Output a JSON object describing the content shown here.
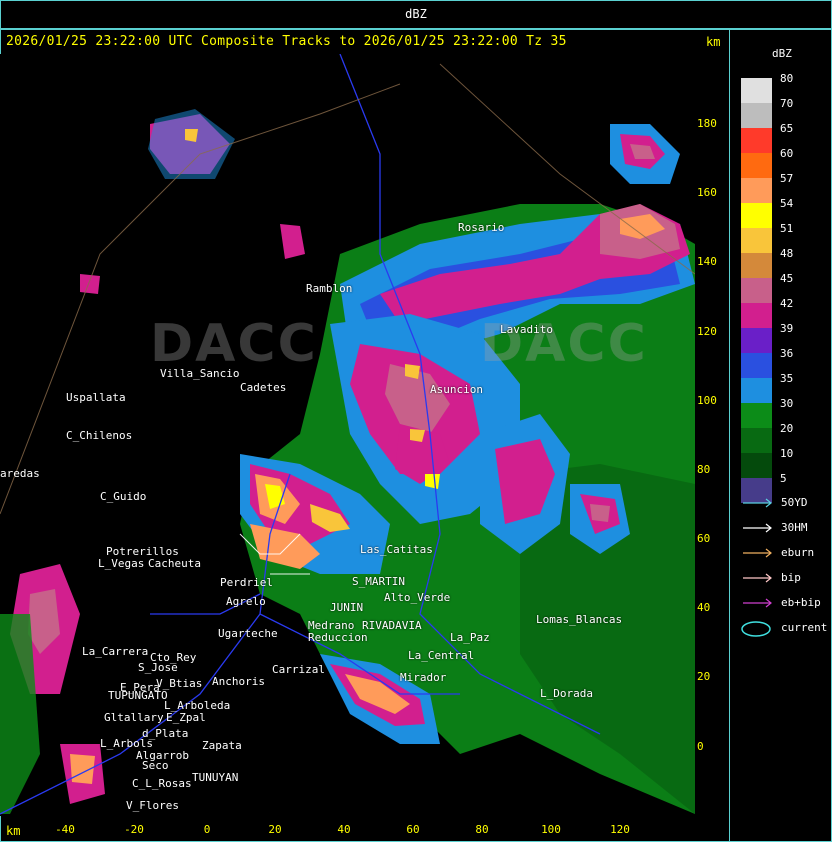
{
  "top_title": "dBZ",
  "header": "2026/01/25 23:22:00 UTC Composite Tracks to 2026/01/25 23:22:00 Tz 35",
  "km_top": "km",
  "km_bottom": "km",
  "y_ticks": [
    "180",
    "160",
    "140",
    "120",
    "100",
    "80",
    "60",
    "40",
    "20",
    "0"
  ],
  "x_ticks": [
    "-40",
    "-20",
    "0",
    "20",
    "40",
    "60",
    "80",
    "100",
    "120"
  ],
  "places": [
    "Ramblon",
    "Villa_Sancio",
    "Uspallata",
    "C_Chilenos",
    "aredas",
    "C_Guido",
    "Potrerillos",
    "L_Vegas",
    "Cacheuta",
    "Perdriel",
    "Agrelo",
    "Ugarteche",
    "La_Carrera",
    "Cto_Rey",
    "S_Jose",
    "E_Pera",
    "V_Btias",
    "TUPUNGATO",
    "Anchoris",
    "L_Arboleda",
    "Gltallary",
    "E_Zpal",
    "d_Plata",
    "L_Arbols",
    "Zapata",
    "Algarrob",
    "Seco",
    "C_L_Rosas",
    "TUNUYAN",
    "V_Flores",
    "Carrizal",
    "S_MARTIN",
    "RIVADAVIA",
    "JUNIN",
    "Medrano",
    "Reduccion",
    "Lomas_Blancas",
    "L_Dorada",
    "Rosario",
    "Lavadito",
    "Asuncion",
    "Cadetes",
    "Alto_Verde",
    "La_Central",
    "Mirador",
    "La_Paz",
    "Las_Catitas"
  ],
  "watermarks": [
    "DACC",
    "DACC"
  ],
  "legend": {
    "title": "dBZ",
    "levels": [
      {
        "label": "80",
        "color": "#e0e0e0"
      },
      {
        "label": "70",
        "color": "#bdbdbd"
      },
      {
        "label": "65",
        "color": "#ff3a2a"
      },
      {
        "label": "60",
        "color": "#ff6a10"
      },
      {
        "label": "57",
        "color": "#ff9b5a"
      },
      {
        "label": "54",
        "color": "#ffff00"
      },
      {
        "label": "51",
        "color": "#f9c53a"
      },
      {
        "label": "48",
        "color": "#d4893a"
      },
      {
        "label": "45",
        "color": "#c8608a"
      },
      {
        "label": "42",
        "color": "#d21f8e"
      },
      {
        "label": "39",
        "color": "#6a1fc8"
      },
      {
        "label": "36",
        "color": "#2a50e0"
      },
      {
        "label": "35",
        "color": "#1e8fe0"
      },
      {
        "label": "30",
        "color": "#0c8c18"
      },
      {
        "label": "20",
        "color": "#086a12"
      },
      {
        "label": "10",
        "color": "#044a0c"
      },
      {
        "label": "5",
        "color": "#463c8a"
      }
    ],
    "tracks": [
      {
        "label": "50YD",
        "color": "#5ad0e0"
      },
      {
        "label": "30HM",
        "color": "#ffffff"
      },
      {
        "label": "eburn",
        "color": "#f0b060"
      },
      {
        "label": "bip",
        "color": "#ffc8c8"
      },
      {
        "label": "eb+bip",
        "color": "#d040d0"
      }
    ],
    "current_label": "current",
    "current_color": "#40e0e0"
  }
}
